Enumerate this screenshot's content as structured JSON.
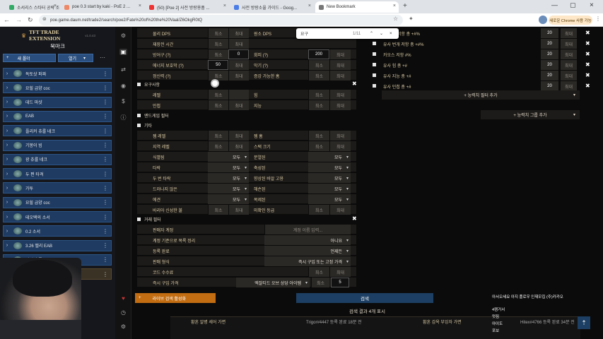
{
  "browser": {
    "tabs": [
      "소서리스 스타터 공략 조반만 ...",
      "poe 0.3 start by kaki - PoE 2 ...",
      "(50) [Poe 2] 사전 방랑용품 ...",
      "사전 방랑소울 가이드 - Goog...",
      "New Bookmark"
    ],
    "url": "poe.game.daum.net/trade2/search/poe2/Fate%20of%20the%20Vaal/Z6OkgR0tQ",
    "profile_badge": "새로운 Chrome 사용 가능"
  },
  "find_bar": {
    "query": "요구",
    "count": "1/11"
  },
  "extension": {
    "title": "TFT TRADE EXTENSION",
    "version": "v1.0.43",
    "subtitle": "북마크",
    "new_folder": "새 폴더",
    "open": "열기",
    "items": [
      "독토샷 퍼짜",
      "요힐 급양 coc",
      "데드 마샷",
      "EAB",
      "플리커 츄룰 네크",
      "기봉이 빔",
      "광 츄룰 네크",
      "두 편 타격",
      "가투",
      "요힐 급양 coc",
      "테오택의 소서",
      "0.2 소서",
      "3.26 벨리 EAB",
      "신성 츄룰",
      "사이클론 리스트리 쁘디어"
    ]
  },
  "rail_icons": [
    "gear-icon",
    "bookmark-icon",
    "swap-icon",
    "eye-icon",
    "dollar-icon",
    "info-icon",
    "heart-icon",
    "history-icon",
    "settings-icon"
  ],
  "defense_rows": [
    {
      "l": "물리 DPS",
      "a": "최소",
      "b": "최대",
      "l2": "원소 DPS",
      "a2": "최소",
      "b2": "최대"
    },
    {
      "l": "재장전 시간",
      "a": "최소",
      "b": "최대",
      "l2": "",
      "a2": "",
      "b2": ""
    },
    {
      "l": "방어구 (?)",
      "a": "최소",
      "b": "0",
      "l2": "회피 (?)",
      "a2": "200",
      "b2": "최대"
    },
    {
      "l": "에너지 보호막 (?)",
      "a": "50",
      "b": "최대",
      "l2": "막기 (?)",
      "a2": "최소",
      "b2": "최대"
    },
    {
      "l": "정신력 (?)",
      "a": "최소",
      "b": "최대",
      "l2": "증강 가능한 홈",
      "a2": "최소",
      "b2": "최대"
    }
  ],
  "req_section": "요구사항",
  "req_rows": [
    {
      "l": "레벨",
      "a": "최소",
      "b": "",
      "l2": "힘",
      "a2": "최소",
      "b2": "최대"
    },
    {
      "l": "민첩",
      "a": "최소",
      "b": "최대",
      "l2": "지능",
      "a2": "최소",
      "b2": "최대"
    }
  ],
  "endgame": "엔드게임 필터",
  "misc_section": "기타",
  "misc_rows": [
    {
      "l": "젬 레벨",
      "a": "최소",
      "b": "최대",
      "l2": "젬 홈",
      "a2": "최소",
      "b2": "최대"
    },
    {
      "l": "지역 레벨",
      "a": "최소",
      "b": "최대",
      "l2": "스택 크기",
      "a2": "최소",
      "b2": "최대"
    },
    {
      "l": "식별됨",
      "d": "모두",
      "l2": "분열된",
      "d2": "모두"
    },
    {
      "l": "타락",
      "d": "모두",
      "l2": "축성된",
      "d2": "모두"
    },
    {
      "l": "두 번 타락",
      "d": "모두",
      "l2": "향상된 바알 고용",
      "d2": "모두"
    },
    {
      "l": "드러나지 않은",
      "d": "모두",
      "l2": "해손된",
      "d2": "모두"
    },
    {
      "l": "에견",
      "d": "모두",
      "l2": "복제된",
      "d2": "모두"
    },
    {
      "l": "바리아 신성한 불",
      "a": "최소",
      "b": "최대",
      "l2": "미확인 등급",
      "a2": "최소",
      "b2": "최대"
    }
  ],
  "trade_section": "거래 필터",
  "trade_rows": [
    {
      "l": "판매자 계정",
      "v": "계정 이름 입력..."
    },
    {
      "l": "계정 기준으로 목록 정리",
      "v": "아니요"
    },
    {
      "l": "등록 완료",
      "v": "언제든"
    },
    {
      "l": "판매 형식",
      "v": "즉시 구입 또는 고정 가격"
    },
    {
      "l": "코드 수수료",
      "a": "최소",
      "b": "최대"
    },
    {
      "l": "즉시 구입 가격",
      "v": "엑잘티드 오브 상당 아이템",
      "n": "최소",
      "m": "5"
    }
  ],
  "right_rows": [
    {
      "l": "유사 소 저항 총 +#%",
      "a": "20",
      "b": "최대"
    },
    {
      "l": "유사 번개 저항 총 +#%",
      "a": "20",
      "b": "최대"
    },
    {
      "l": "카오스 저항 #%",
      "a": "20",
      "b": "최대"
    },
    {
      "l": "유사 힘 총 +#",
      "a": "20",
      "b": "최대"
    },
    {
      "l": "유사 지능 총 +#",
      "a": "20",
      "b": "최대"
    },
    {
      "l": "유사 민첩 총 +#",
      "a": "20",
      "b": "최대"
    }
  ],
  "add_stat": "+ 능력치 필터 추가",
  "add_group": "+ 능력치 그룹 추가",
  "live_search": "라이브 검색 활성화",
  "search": "검색",
  "results_title": "검색 결과 4개 표시",
  "result_names": [
    "황혼 알병 세어 가면",
    "Trigor#4447 등록 완료 18분 전",
    "황혼 감옥 부잉자 가면",
    "Hitex#4766 등록 완료 34분 전"
  ],
  "chat": [
    "아서오세요 아지 플로우 인재모집 (주)카카오",
    "4캠거서",
    "멋짐",
    "아이도",
    "포보"
  ]
}
